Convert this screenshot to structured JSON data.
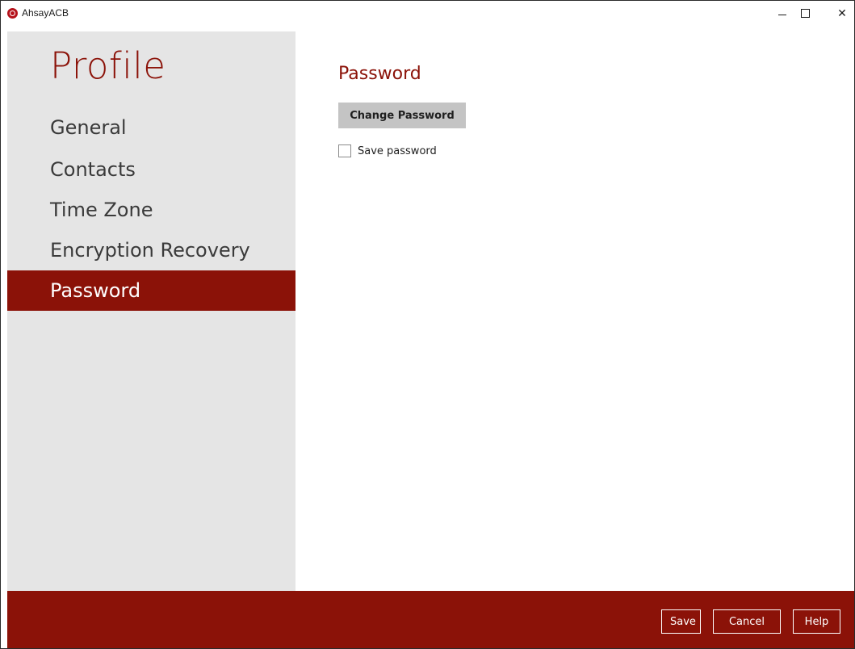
{
  "window": {
    "title": "AhsayACB",
    "controls": {
      "minimize": "minimize-icon",
      "maximize": "maximize-icon",
      "close": "close-icon"
    }
  },
  "sidebar": {
    "title": "Profile",
    "items": [
      {
        "label": "General",
        "active": false
      },
      {
        "label": "Contacts",
        "active": false
      },
      {
        "label": "Time Zone",
        "active": false
      },
      {
        "label": "Encryption Recovery",
        "active": false
      },
      {
        "label": "Password",
        "active": true
      }
    ]
  },
  "main": {
    "section_title": "Password",
    "change_password_label": "Change Password",
    "save_password": {
      "label": "Save password",
      "checked": false
    }
  },
  "footer": {
    "save_label": "Save",
    "cancel_label": "Cancel",
    "help_label": "Help"
  },
  "colors": {
    "accent": "#8b1208",
    "sidebar_bg": "#e5e5e5",
    "button_bg": "#c4c4c4"
  }
}
